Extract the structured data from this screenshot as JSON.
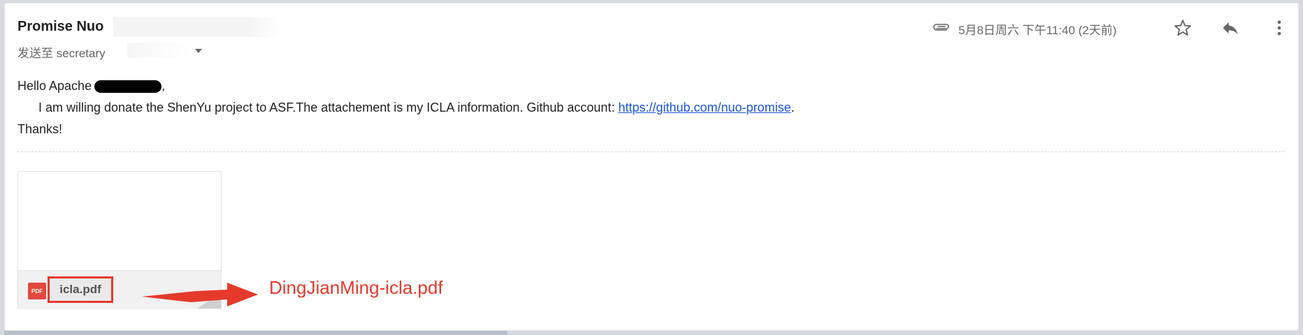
{
  "email": {
    "sender_name": "Promise Nuo",
    "to_prefix": "发送至",
    "to_value": "secretary",
    "date": "5月8日周六 下午11:40 (2天前)",
    "body": {
      "greeting": "Hello Apache",
      "greeting_suffix": ",",
      "line_1_text": "I am willing donate the ShenYu project to ASF.The attachement is my ICLA information. Github account: ",
      "github_link": "https://github.com/nuo-promise",
      "line_1_end": ".",
      "closing": "Thanks!"
    },
    "attachment": {
      "badge": "PDF",
      "file_name": "icla.pdf"
    }
  },
  "annotation": {
    "text": "DingJianMing-icla.pdf",
    "color": "#e53a2b"
  },
  "icons": {
    "attachment": "paperclip-icon",
    "star": "star-icon",
    "reply": "reply-icon",
    "more": "more-vertical-icon",
    "dropdown": "chevron-down-icon",
    "arrow": "arrow-right-icon"
  },
  "colors": {
    "link": "#1a55d6",
    "highlight": "#e53a2b",
    "pdf_badge": "#e04a3c"
  }
}
